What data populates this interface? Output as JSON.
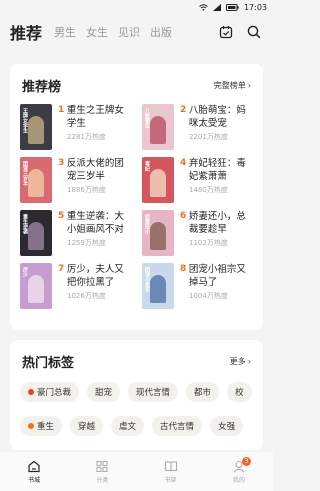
{
  "status": {
    "time": "17:03"
  },
  "topnav": {
    "tabs": [
      {
        "label": "推荐",
        "active": true
      },
      {
        "label": "男生"
      },
      {
        "label": "女生"
      },
      {
        "label": "见识"
      },
      {
        "label": "出版"
      }
    ],
    "icons": [
      "calendar-icon",
      "search-icon"
    ]
  },
  "ranking": {
    "title": "推荐榜",
    "more_label": "完整榜单",
    "items": [
      {
        "rank": "1",
        "name": "重生之王牌女学生",
        "heat": "2281万热度",
        "cover_color": "#3c3c44",
        "cover_text": "王牌女学生",
        "fig_color": "#c9b48a"
      },
      {
        "rank": "2",
        "name": "八胎萌宝：妈咪太受宠",
        "heat": "2201万热度",
        "cover_color": "#e9c7cf",
        "cover_text": "八胎萌宝",
        "fig_color": "#b84a5e"
      },
      {
        "rank": "3",
        "name": "反派大佬的团宠三岁半",
        "heat": "1886万热度",
        "cover_color": "#d96a72",
        "cover_text": "团宠三岁半",
        "fig_color": "#f3d2a6"
      },
      {
        "rank": "4",
        "name": "弃妃轻狂：毒妃紫萧萧",
        "heat": "1480万热度",
        "cover_color": "#d4565e",
        "cover_text": "毒妃",
        "fig_color": "#f5e0c8"
      },
      {
        "rank": "5",
        "name": "重生逆袭：大小姐画风不对",
        "heat": "1259万热度",
        "cover_color": "#2c2a30",
        "cover_text": "重生逆袭",
        "fig_color": "#a38aa8"
      },
      {
        "rank": "6",
        "name": "娇妻还小，总裁要趁早",
        "heat": "1102万热度",
        "cover_color": "#e7b6c4",
        "cover_text": "娇妻还小",
        "fig_color": "#7d5a4c"
      },
      {
        "rank": "7",
        "name": "厉少，夫人又把你拉黑了",
        "heat": "1026万热度",
        "cover_color": "#c79cd0",
        "cover_text": "厉少",
        "fig_color": "#f4e6f0"
      },
      {
        "rank": "8",
        "name": "团宠小祖宗又掉马了",
        "heat": "1004万热度",
        "cover_color": "#c9d8ea",
        "cover_text": "团宠小祖宗",
        "fig_color": "#4a6fa8"
      }
    ]
  },
  "tags": {
    "title": "热门标签",
    "more_label": "更多",
    "row1": [
      {
        "label": "豪门总裁",
        "dot": "#e8431e"
      },
      {
        "label": "甜宠"
      },
      {
        "label": "现代言情"
      },
      {
        "label": "都市"
      },
      {
        "label": "校"
      }
    ],
    "row2": [
      {
        "label": "重生",
        "dot": "#e8731e"
      },
      {
        "label": "穿越"
      },
      {
        "label": "虐文"
      },
      {
        "label": "古代言情"
      },
      {
        "label": "女强"
      }
    ]
  },
  "bottom_nav": [
    {
      "label": "书城",
      "icon": "home-icon",
      "active": true
    },
    {
      "label": "分类",
      "icon": "category-icon"
    },
    {
      "label": "书架",
      "icon": "bookshelf-icon"
    },
    {
      "label": "我的",
      "icon": "profile-icon",
      "badge": "3"
    }
  ]
}
